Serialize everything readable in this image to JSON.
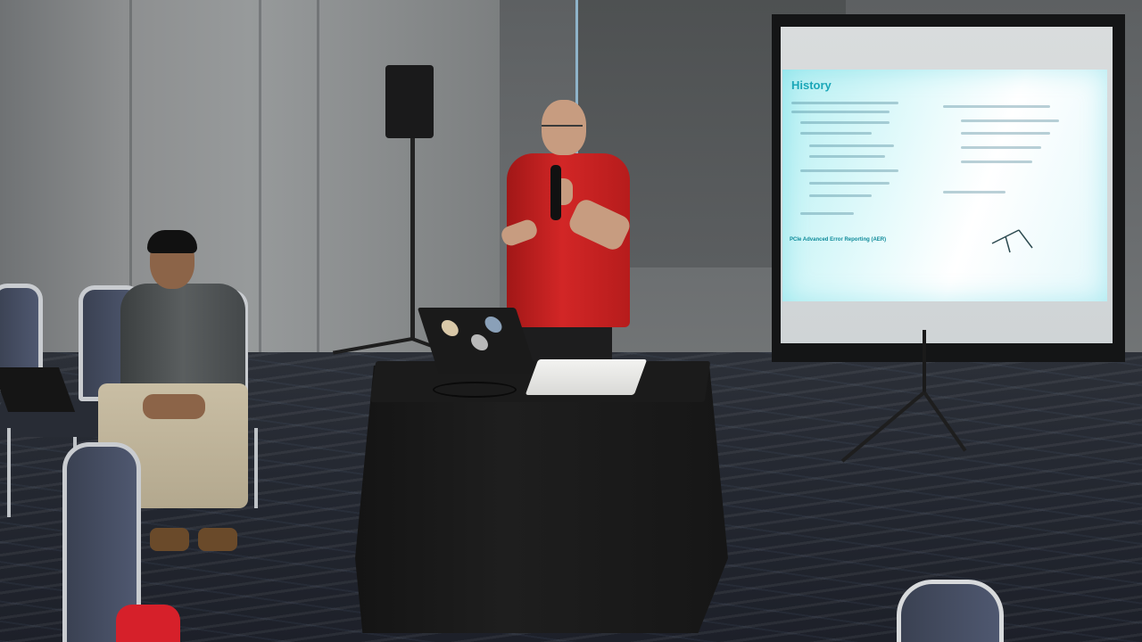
{
  "scene": {
    "description_colors": {
      "slide_accent": "#1aa7b8",
      "presenter_shirt": "#d22626",
      "table_cloth": "#1e1e1e",
      "floor": "#232730"
    }
  },
  "slide": {
    "title": "History",
    "footer": "PCIe Advanced Error Reporting (AER)"
  }
}
